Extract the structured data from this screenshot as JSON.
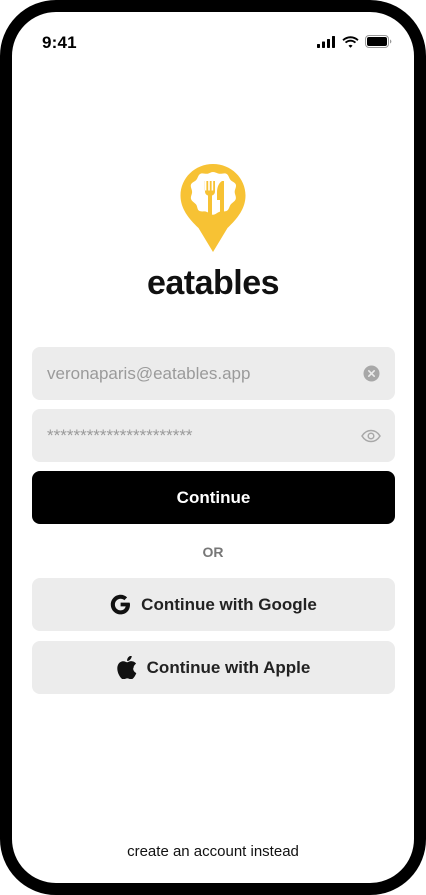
{
  "status_bar": {
    "time": "9:41"
  },
  "brand": {
    "name": "eatables",
    "logo_color": "#F7C234"
  },
  "form": {
    "email_placeholder": "veronaparis@eatables.app",
    "password_masked": "**********************",
    "continue_label": "Continue",
    "divider_label": "OR"
  },
  "social": {
    "google_label": "Continue with Google",
    "apple_label": "Continue with Apple"
  },
  "footer": {
    "create_account_label": "create an account instead"
  },
  "icons": {
    "email_clear": "clear-icon",
    "password_toggle": "eye-icon",
    "google": "google-icon",
    "apple": "apple-icon"
  }
}
